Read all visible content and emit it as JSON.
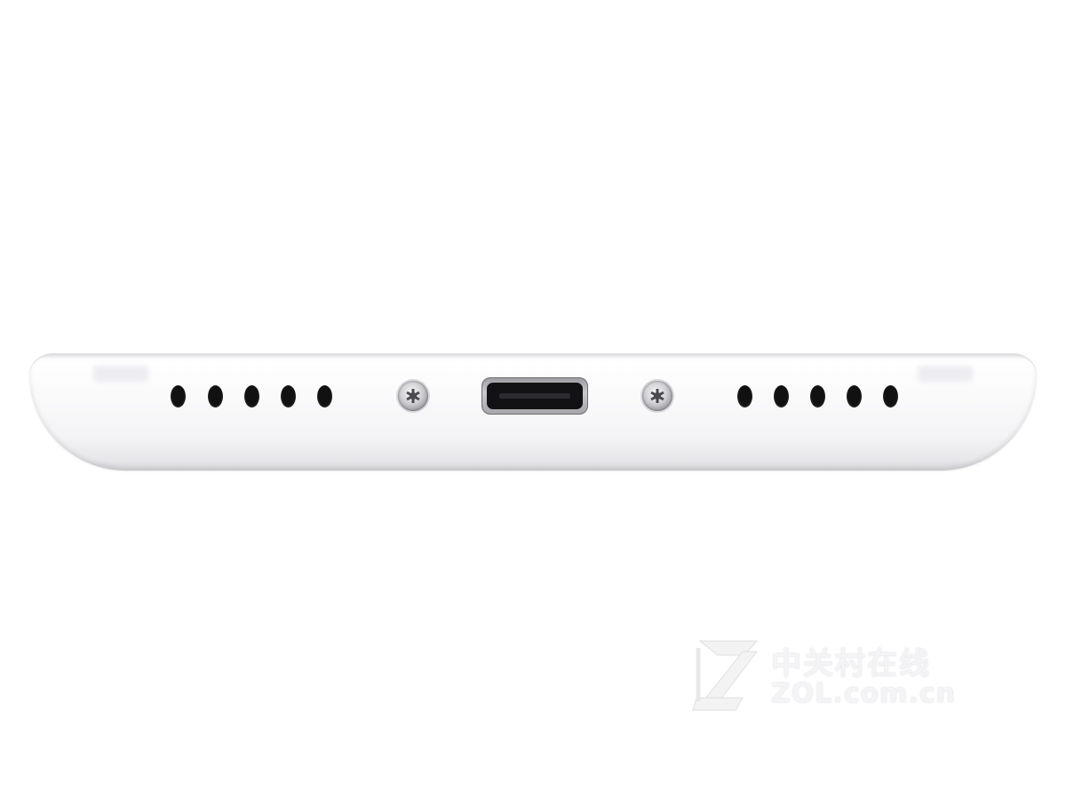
{
  "scene": {
    "subject": "phone-bottom-edge",
    "background_color": "#ffffff",
    "body_color": "#f7f7f9"
  },
  "watermark": {
    "brand_cn": "中关村在线",
    "brand_url": "ZOL.com.cn",
    "logo_letter": "Z"
  }
}
